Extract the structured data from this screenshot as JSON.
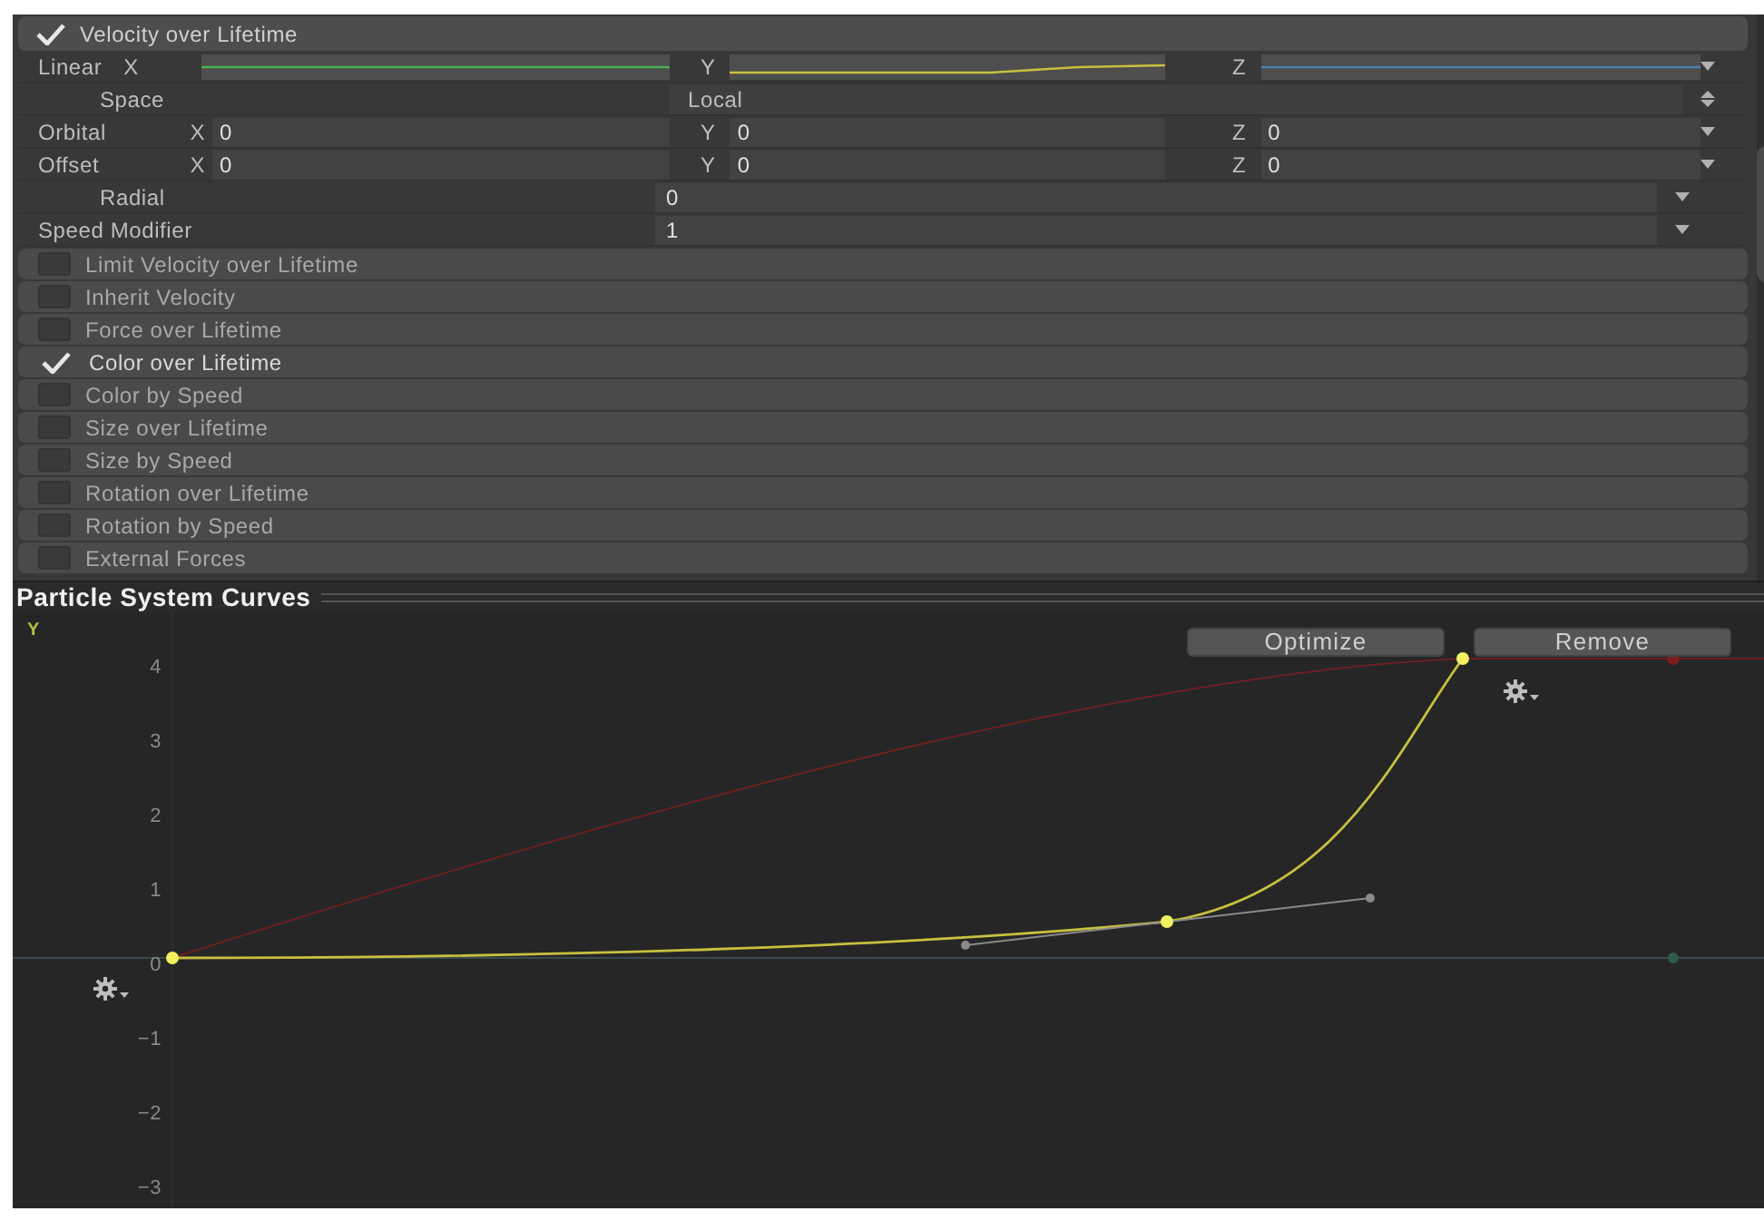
{
  "velocity_module": {
    "title": "Velocity over Lifetime",
    "checked": true
  },
  "properties": [
    {
      "kind": "curves",
      "label": "Linear",
      "indent": false,
      "fields": [
        {
          "axis": "X",
          "kind": "flat",
          "color": "#4caf50"
        },
        {
          "axis": "Y",
          "kind": "rising",
          "color": "#c8c040"
        },
        {
          "axis": "Z",
          "kind": "flat",
          "color": "#4a7fb0"
        }
      ]
    },
    {
      "kind": "dropdown",
      "label": "Space",
      "indent": true,
      "value": "Local"
    },
    {
      "kind": "xyz",
      "label": "Orbital",
      "indent": false,
      "fields": [
        {
          "axis": "X",
          "value": "0"
        },
        {
          "axis": "Y",
          "value": "0"
        },
        {
          "axis": "Z",
          "value": "0"
        }
      ]
    },
    {
      "kind": "xyz",
      "label": "Offset",
      "indent": false,
      "fields": [
        {
          "axis": "X",
          "value": "0"
        },
        {
          "axis": "Y",
          "value": "0"
        },
        {
          "axis": "Z",
          "value": "0"
        }
      ]
    },
    {
      "kind": "value",
      "label": "Radial",
      "indent": true,
      "value": "0"
    },
    {
      "kind": "value",
      "label": "Speed Modifier",
      "indent": false,
      "value": "1"
    }
  ],
  "modules": [
    {
      "title": "Limit Velocity over Lifetime",
      "checked": false
    },
    {
      "title": "Inherit Velocity",
      "checked": false
    },
    {
      "title": "Force over Lifetime",
      "checked": false
    },
    {
      "title": "Color over Lifetime",
      "checked": true
    },
    {
      "title": "Color by Speed",
      "checked": false
    },
    {
      "title": "Size over Lifetime",
      "checked": false
    },
    {
      "title": "Size by Speed",
      "checked": false
    },
    {
      "title": "Rotation over Lifetime",
      "checked": false
    },
    {
      "title": "Rotation by Speed",
      "checked": false
    },
    {
      "title": "External Forces",
      "checked": false
    }
  ],
  "curves": {
    "title": "Particle System Curves",
    "axis_name": "Y",
    "buttons": [
      "Optimize",
      "Remove"
    ],
    "ticks": [
      "4",
      "3",
      "2",
      "1",
      "0",
      "−1",
      "−2",
      "−3"
    ]
  }
}
